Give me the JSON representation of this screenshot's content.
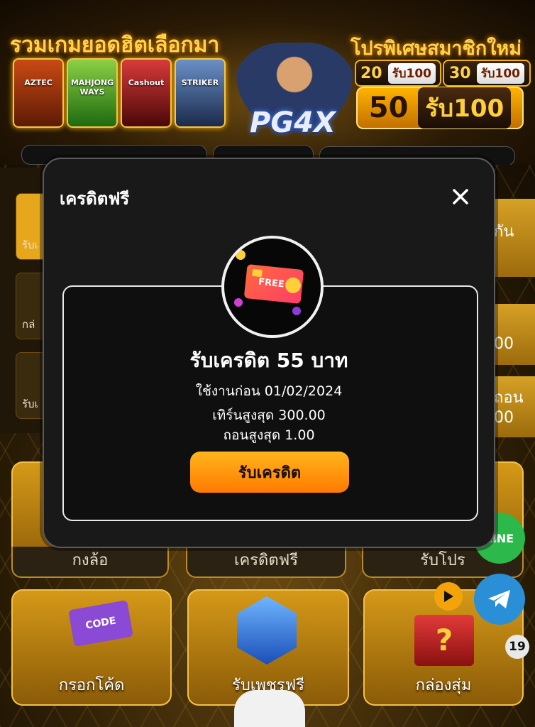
{
  "banner": {
    "headline_left": "รวมเกมยอดฮิตเลือกมา",
    "headline_right": "โปรพิเศษสมาชิกใหม่",
    "games": [
      "AZTEC",
      "MAHJONG WAYS",
      "Cashout",
      "STRIKER"
    ],
    "promos": [
      {
        "amount": "20",
        "tag": "รับ100"
      },
      {
        "amount": "30",
        "tag": "รับ100"
      }
    ],
    "big_promo": {
      "amount": "50",
      "tag": "รับ100"
    },
    "brand": "PG4X"
  },
  "side_tabs": [
    "รับเ",
    "กล่",
    "รับเ"
  ],
  "tiles": {
    "row1": [
      "กงล้อ",
      "เครดิตฟรี",
      "รับโปร"
    ],
    "row2": [
      "กรอกโค้ด",
      "รับเพชรฟรี",
      "กล่องสุ่ม"
    ]
  },
  "right_cards": [
    "กัน",
    "00",
    "ถอน",
    "00"
  ],
  "floating": {
    "line_label": "LINE",
    "badge_count": "19"
  },
  "modal": {
    "title": "เครดิตฟรี",
    "card_text": "FREE",
    "credit_amount": "รับเครดิต 55 บาท",
    "valid_before": "ใช้งานก่อน 01/02/2024",
    "max_turnover": "เทิร์นสูงสุด 300.00",
    "max_withdraw": "ถอนสูงสุด 1.00",
    "claim_label": "รับเครดิต"
  },
  "colors": {
    "accent": "#ff9a0a",
    "gold": "#f2c04a",
    "modal_bg": "#191919"
  }
}
